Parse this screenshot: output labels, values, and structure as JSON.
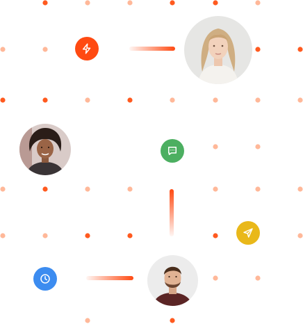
{
  "colors": {
    "accent": "#FF4A12",
    "dot_bright": "#FF5A1F",
    "dot_light": "#FFB899",
    "badge_lightning": "#FF4A12",
    "badge_chat": "#4CAF61",
    "badge_send": "#E9B81A",
    "badge_clock": "#3C8CF0"
  },
  "badges": [
    {
      "id": "lightning",
      "icon": "lightning-icon"
    },
    {
      "id": "chat",
      "icon": "chat-icon"
    },
    {
      "id": "send",
      "icon": "send-icon"
    },
    {
      "id": "clock",
      "icon": "clock-icon"
    }
  ],
  "avatars": [
    {
      "id": "woman-blonde",
      "icon": "avatar"
    },
    {
      "id": "woman-curly",
      "icon": "avatar"
    },
    {
      "id": "man-beard",
      "icon": "avatar"
    }
  ]
}
